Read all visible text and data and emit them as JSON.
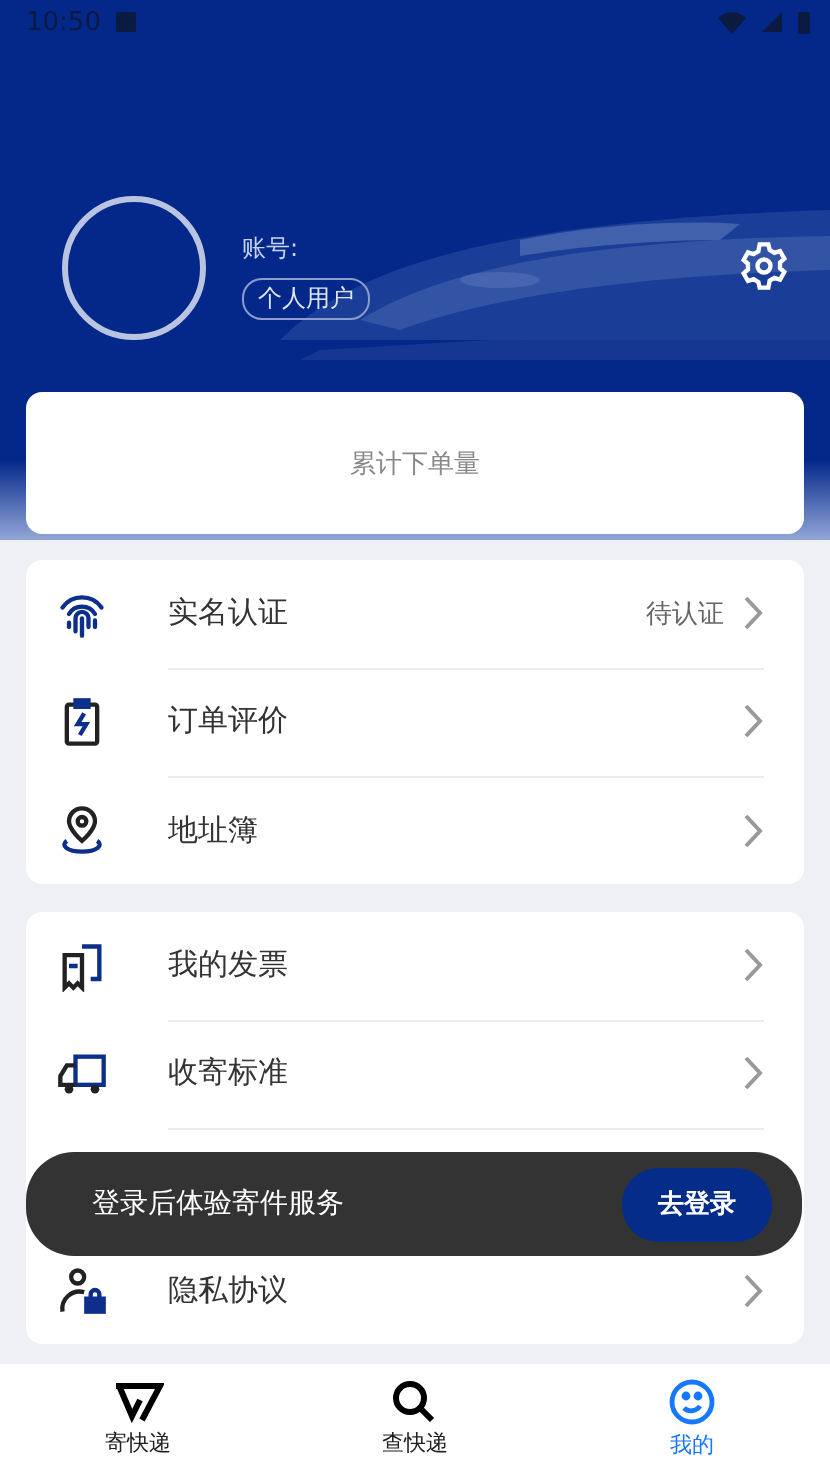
{
  "status_bar": {
    "time": "10:50"
  },
  "profile": {
    "account_label": "账号:",
    "user_type": "个人用户"
  },
  "stats_card": {
    "label": "累计下单量"
  },
  "menu_groups": [
    {
      "items": [
        {
          "label": "实名认证",
          "status": "待认证"
        },
        {
          "label": "订单评价"
        },
        {
          "label": "地址簿"
        }
      ]
    },
    {
      "items": [
        {
          "label": "我的发票"
        },
        {
          "label": "收寄标准"
        },
        {
          "kind": "covered"
        },
        {
          "label": "隐私协议"
        }
      ]
    }
  ],
  "snackbar": {
    "message": "登录后体验寄件服务",
    "action": "去登录"
  },
  "bottom_nav": [
    {
      "label": "寄快递",
      "selected": false
    },
    {
      "label": "查快递",
      "selected": false
    },
    {
      "label": "我的",
      "selected": true
    }
  ]
}
